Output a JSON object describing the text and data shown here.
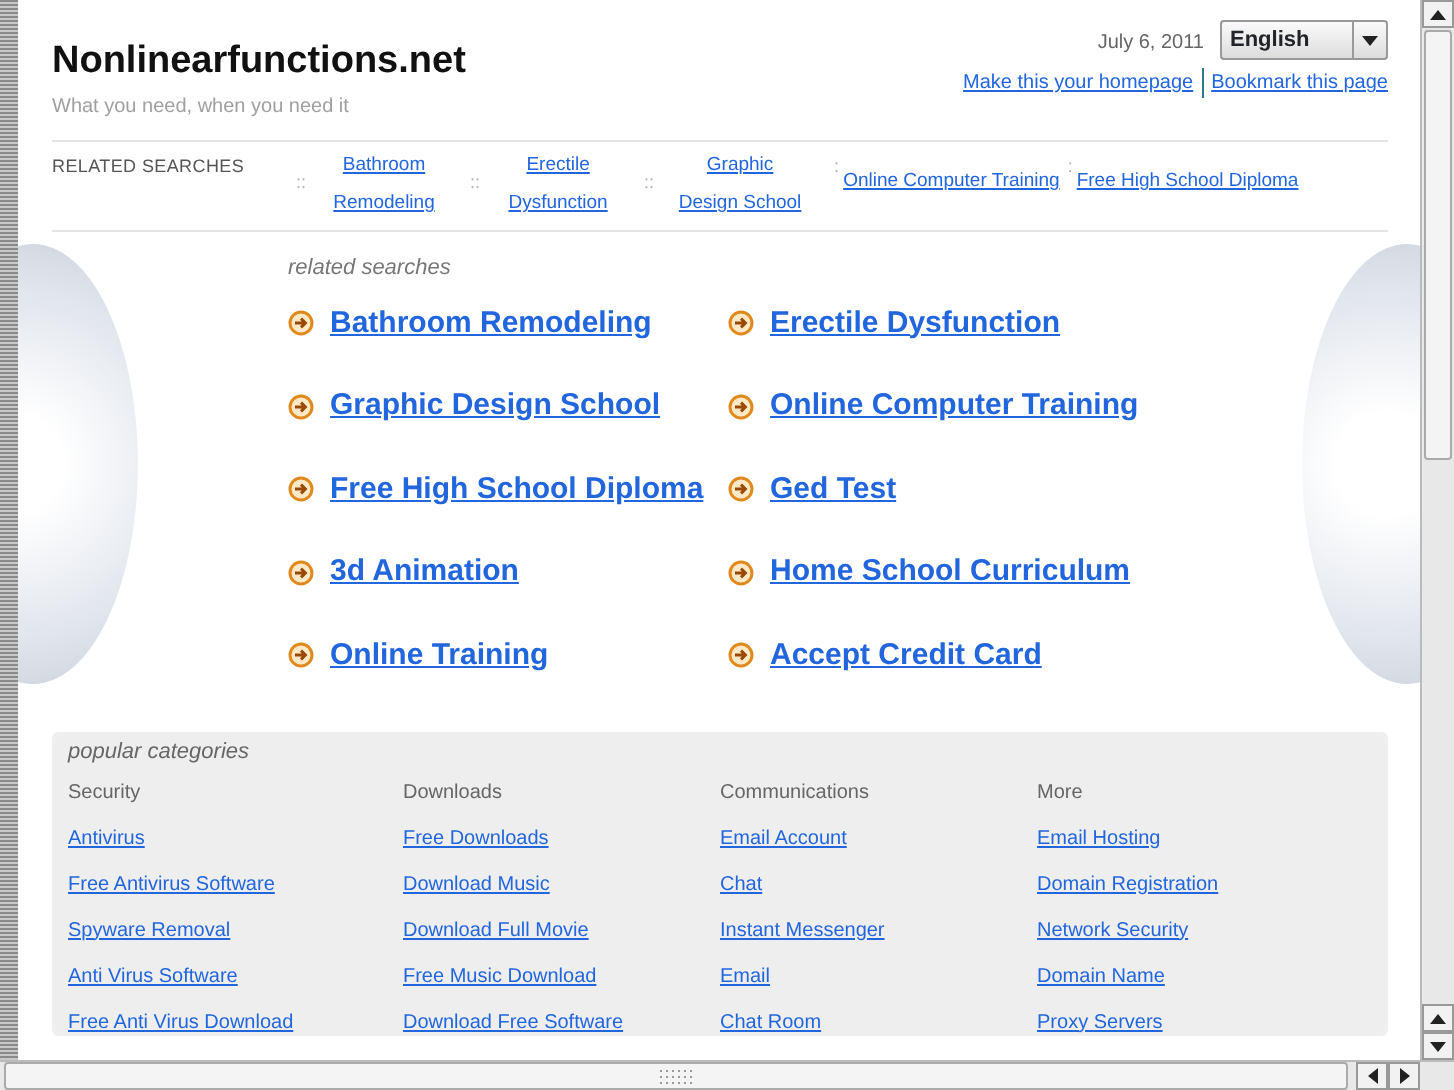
{
  "site": {
    "title": "Nonlinearfunctions.net",
    "tagline": "What you need, when you need it",
    "date": "July 6, 2011",
    "language": "English",
    "links": [
      "Make this your homepage",
      "Bookmark this page"
    ]
  },
  "related_bar": {
    "label": "RELATED SEARCHES",
    "items": [
      {
        "separator": "::",
        "text": "Bathroom Remodeling"
      },
      {
        "separator": "::",
        "text": "Erectile Dysfunction"
      },
      {
        "separator": "::",
        "text": "Graphic Design School"
      },
      {
        "separator": ":",
        "text": "Online Computer Training"
      },
      {
        "separator": ":",
        "text": "Free High School Diploma"
      }
    ]
  },
  "related_searches": {
    "heading": "related searches",
    "links": [
      "Bathroom Remodeling",
      "Erectile Dysfunction",
      "Graphic Design School",
      "Online Computer Training",
      "Free High School Diploma",
      "Ged Test",
      "3d Animation",
      "Home School Curriculum",
      "Online Training",
      "Accept Credit Card"
    ]
  },
  "popular_categories": {
    "heading": "popular categories",
    "columns": [
      {
        "title": "Security",
        "links": [
          "Antivirus",
          "Free Antivirus Software",
          "Spyware Removal",
          "Anti Virus Software",
          "Free Anti Virus Download"
        ]
      },
      {
        "title": "Downloads",
        "links": [
          "Free Downloads",
          "Download Music",
          "Download Full Movie",
          "Free Music Download",
          "Download Free Software"
        ]
      },
      {
        "title": "Communications",
        "links": [
          "Email Account",
          "Chat",
          "Instant Messenger",
          "Email",
          "Chat Room"
        ]
      },
      {
        "title": "More",
        "links": [
          "Email Hosting",
          "Domain Registration",
          "Network Security",
          "Domain Name",
          "Proxy Servers"
        ]
      }
    ]
  }
}
